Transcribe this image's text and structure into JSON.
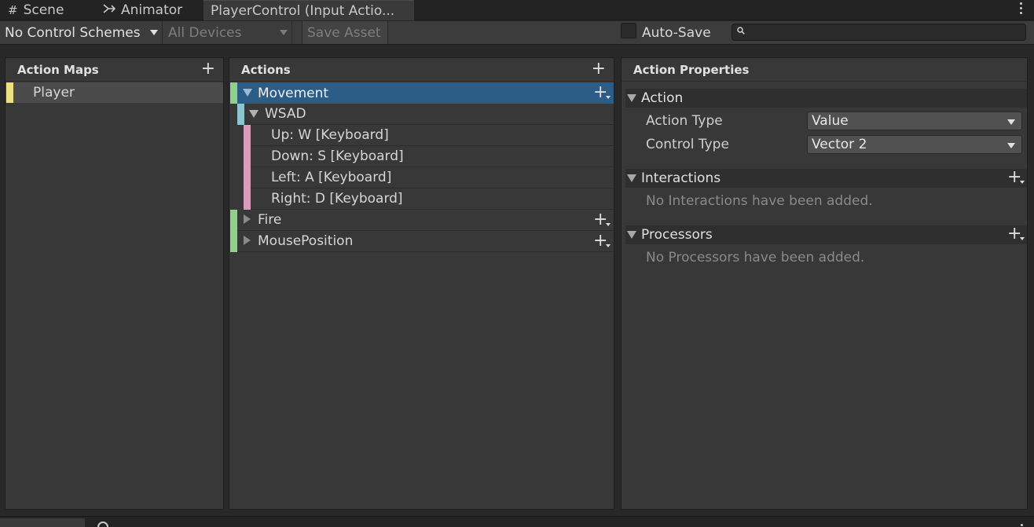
{
  "tabs": {
    "scene": "Scene",
    "animator": "Animator",
    "active": "PlayerControl (Input Actio..."
  },
  "toolbar": {
    "control_schemes": "No Control Schemes",
    "devices": "All Devices",
    "save_asset": "Save Asset",
    "auto_save": "Auto-Save",
    "search_placeholder": ""
  },
  "action_maps": {
    "title": "Action Maps",
    "items": [
      {
        "label": "Player",
        "color": "#ede080"
      }
    ]
  },
  "actions": {
    "title": "Actions",
    "rows": [
      {
        "label": "Movement",
        "kind": "action",
        "expanded": true,
        "selected": true,
        "color": "#8fd18a"
      },
      {
        "label": "WSAD",
        "kind": "composite",
        "expanded": true,
        "color": "#8ec4cc"
      },
      {
        "label": "Up: W [Keyboard]",
        "kind": "binding",
        "color": "#d79dbb"
      },
      {
        "label": "Down: S [Keyboard]",
        "kind": "binding",
        "color": "#d79dbb"
      },
      {
        "label": "Left: A [Keyboard]",
        "kind": "binding",
        "color": "#d79dbb"
      },
      {
        "label": "Right: D [Keyboard]",
        "kind": "binding",
        "color": "#d79dbb"
      },
      {
        "label": "Fire",
        "kind": "action",
        "expanded": false,
        "color": "#8fd18a"
      },
      {
        "label": "MousePosition",
        "kind": "action",
        "expanded": false,
        "color": "#8fd18a"
      }
    ]
  },
  "properties": {
    "title": "Action Properties",
    "action_section": "Action",
    "action_type_label": "Action Type",
    "action_type_value": "Value",
    "control_type_label": "Control Type",
    "control_type_value": "Vector 2",
    "interactions_section": "Interactions",
    "interactions_empty": "No Interactions have been added.",
    "processors_section": "Processors",
    "processors_empty": "No Processors have been added."
  },
  "colors": {
    "selected_row": "#2c5d87",
    "map_bar": "#ede080",
    "action_bar": "#8fd18a",
    "composite_bar": "#8ec4cc",
    "binding_bar": "#d79dbb"
  }
}
